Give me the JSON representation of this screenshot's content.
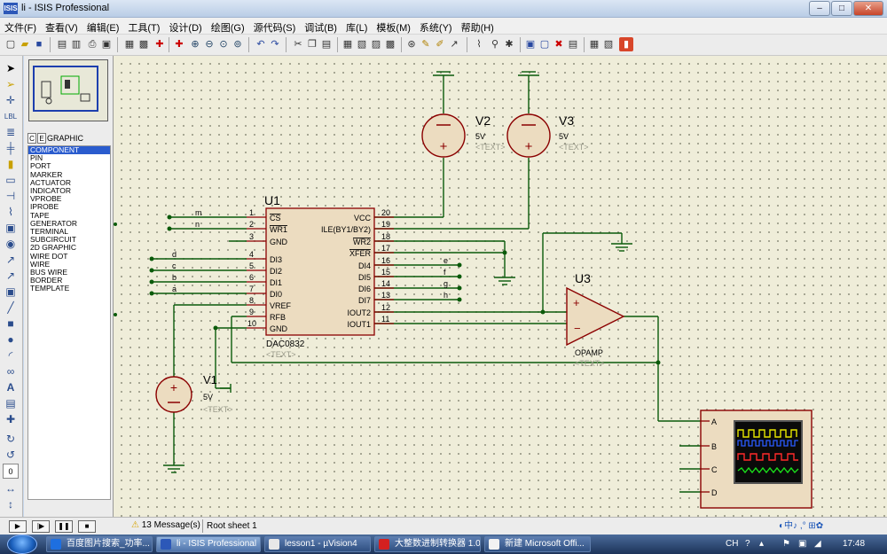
{
  "window": {
    "app_icon": "ISIS",
    "title": "li - ISIS Professional",
    "minimize": "–",
    "maximize": "□",
    "close": "✕"
  },
  "menu": [
    "文件(F)",
    "查看(V)",
    "编辑(E)",
    "工具(T)",
    "设计(D)",
    "绘图(G)",
    "源代码(S)",
    "调试(B)",
    "库(L)",
    "模板(M)",
    "系统(Y)",
    "帮助(H)"
  ],
  "selector": {
    "tabs": [
      "C",
      "E"
    ],
    "header": "GRAPHIC STYLES",
    "items": [
      "COMPONENT",
      "PIN",
      "PORT",
      "MARKER",
      "ACTUATOR",
      "INDICATOR",
      "VPROBE",
      "IPROBE",
      "TAPE",
      "GENERATOR",
      "TERMINAL",
      "SUBCIRCUIT",
      "2D GRAPHIC",
      "WIRE DOT",
      "WIRE",
      "BUS WIRE",
      "BORDER",
      "TEMPLATE"
    ],
    "selected_index": 0
  },
  "schematic": {
    "u1": {
      "ref": "U1",
      "part": "DAC0832",
      "text": "<TEXT>",
      "left_pins": [
        {
          "num": "1",
          "name": "CS",
          "net": "m"
        },
        {
          "num": "2",
          "name": "WR1",
          "net": "n"
        },
        {
          "num": "3",
          "name": "GND",
          "net": ""
        },
        {
          "num": "4",
          "name": "DI3",
          "net": "d"
        },
        {
          "num": "5",
          "name": "DI2",
          "net": "c"
        },
        {
          "num": "6",
          "name": "DI1",
          "net": "b"
        },
        {
          "num": "7",
          "name": "DI0",
          "net": "a"
        },
        {
          "num": "8",
          "name": "VREF",
          "net": ""
        },
        {
          "num": "9",
          "name": "RFB",
          "net": ""
        },
        {
          "num": "10",
          "name": "GND",
          "net": ""
        }
      ],
      "right_pins": [
        {
          "num": "20",
          "name": "VCC",
          "net": ""
        },
        {
          "num": "19",
          "name": "ILE(BY1/BY2)",
          "net": ""
        },
        {
          "num": "18",
          "name": "WR2",
          "net": ""
        },
        {
          "num": "17",
          "name": "XFER",
          "net": ""
        },
        {
          "num": "16",
          "name": "DI4",
          "net": "e"
        },
        {
          "num": "15",
          "name": "DI5",
          "net": "f"
        },
        {
          "num": "14",
          "name": "DI6",
          "net": "g"
        },
        {
          "num": "13",
          "name": "DI7",
          "net": "h"
        },
        {
          "num": "12",
          "name": "IOUT2",
          "net": ""
        },
        {
          "num": "11",
          "name": "IOUT1",
          "net": ""
        }
      ]
    },
    "u3": {
      "ref": "U3",
      "part": "OPAMP",
      "text": "<TEXT>",
      "plus": "+",
      "minus": "−"
    },
    "v1": {
      "ref": "V1",
      "value": "5V",
      "text": "<TEXT>"
    },
    "v2": {
      "ref": "V2",
      "value": "5V",
      "text": "<TEXT>"
    },
    "v3": {
      "ref": "V3",
      "value": "5V",
      "text": "<TEXT>"
    },
    "scope": {
      "channels": [
        "A",
        "B",
        "C",
        "D"
      ]
    }
  },
  "status": {
    "messages": "13 Message(s)",
    "sheet": "Root sheet 1"
  },
  "taskbar": {
    "tasks": [
      "百度图片搜索_功率...",
      "li - ISIS Professional",
      "lesson1 - µVision4",
      "大整数进制转换器 1.0",
      "新建 Microsoft Offi..."
    ],
    "active_index": 1,
    "clock": "17:48",
    "ime": "CH"
  },
  "colors": {
    "wire": "#0a5a0a",
    "component": "#8b0000",
    "component_fill": "#ecdcc0",
    "canvas": "#efedd9"
  }
}
